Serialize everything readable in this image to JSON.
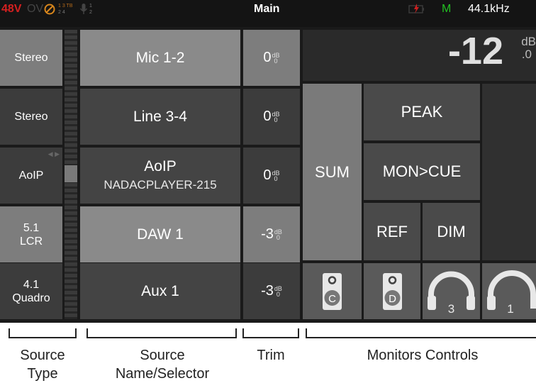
{
  "status_bar": {
    "phantom": "48V",
    "overload": "OV",
    "mini_digits_1": "1 3 TB",
    "mini_digits_2": "2 4",
    "mini_mic_1": "1",
    "mini_mic_2": "2",
    "mode": "Main",
    "indicator": "M",
    "sample_rate": "44.1kHz"
  },
  "sources": [
    {
      "type": "Stereo",
      "name": "Mic 1-2",
      "subname": "",
      "trim": "0"
    },
    {
      "type": "Stereo",
      "name": "Line 3-4",
      "subname": "",
      "trim": "0"
    },
    {
      "type": "AoIP",
      "name": "AoIP",
      "subname": "NADACPLAYER-215",
      "trim": "0"
    },
    {
      "type_line1": "5.1",
      "type_line2": "LCR",
      "name": "DAW 1",
      "subname": "",
      "trim": "-3"
    },
    {
      "type_line1": "4.1",
      "type_line2": "Quadro",
      "name": "Aux 1",
      "subname": "",
      "trim": "-3"
    }
  ],
  "trim_unit_top": "dB",
  "trim_unit_bottom": "0",
  "level": {
    "value": "-12",
    "unit": "dB",
    "decimal": ".0"
  },
  "controls": {
    "sum": "SUM",
    "peak": "PEAK",
    "mon_cue": "MON>CUE",
    "ref": "REF",
    "dim": "DIM"
  },
  "speakers": [
    {
      "icon": "speaker-icon",
      "letter": "C"
    },
    {
      "icon": "speaker-icon",
      "letter": "D"
    },
    {
      "icon": "headphones-icon",
      "number": "3"
    },
    {
      "icon": "headphones-icon",
      "number": "1"
    }
  ],
  "labels": {
    "source_type_1": "Source",
    "source_type_2": "Type",
    "source_name_1": "Source",
    "source_name_2": "Name/Selector",
    "trim": "Trim",
    "monitors": "Monitors Controls"
  },
  "colors": {
    "phantom": "#d42020",
    "indicator": "#22c022",
    "battery": "#cc1f1f"
  }
}
